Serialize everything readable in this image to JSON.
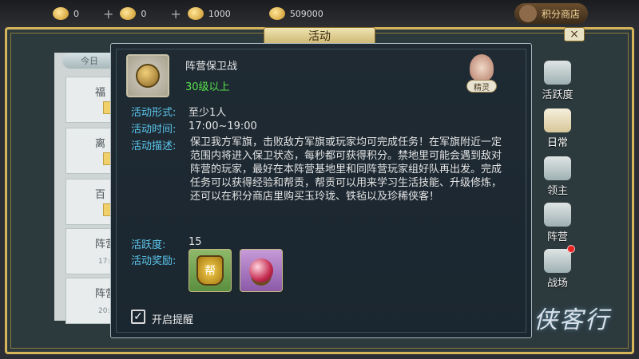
{
  "topbar": {
    "res1": "0",
    "res2": "0",
    "res3": "1000",
    "res4": "509000",
    "shop_label": "积分商店"
  },
  "window": {
    "title": "活动",
    "close": "×"
  },
  "left_list": {
    "tab_label": "今日",
    "cards": [
      {
        "label": "福"
      },
      {
        "label": "离"
      },
      {
        "label": "百"
      },
      {
        "label": "阵营",
        "time": "17:"
      },
      {
        "label": "阵营",
        "time": "20:"
      }
    ]
  },
  "activity": {
    "name": "阵营保卫战",
    "level": "30级以上",
    "spirit_label": "精灵",
    "form_key": "活动形式:",
    "form_val": "至少1人",
    "time_key": "活动时间:",
    "time_val": "17:00~19:00",
    "desc_key": "活动描述:",
    "desc_val": "保卫我方军旗，击败敌方军旗或玩家均可完成任务！在军旗附近一定范围内将进入保卫状态，每秒都可获得积分。禁地里可能会遇到敌对阵营的玩家，最好在本阵营基地里和同阵营玩家组好队再出发。完成任务可以获得经验和帮贡，帮贡可以用来学习生活技能、升级修炼，还可以在积分商店里购买玉玲珑、铁毡以及珍稀侠客！",
    "active_key": "活跃度:",
    "active_val": "15",
    "reward_key": "活动奖励:",
    "reward1_text": "帮",
    "reminder_label": "开启提醒",
    "reminder_checked": "✓"
  },
  "side_nav": [
    {
      "label": "活跃度"
    },
    {
      "label": "日常"
    },
    {
      "label": "领主"
    },
    {
      "label": "阵营"
    },
    {
      "label": "战场"
    }
  ],
  "logo": "侠客行",
  "colors": {
    "key_blue": "#5cc7ee",
    "level_green": "#57e14b",
    "frame_gold": "#d6b45a"
  }
}
